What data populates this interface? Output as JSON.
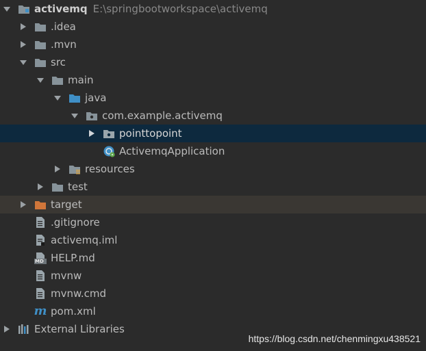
{
  "tree": {
    "root": {
      "label": "activemq",
      "path": "E:\\springbootworkspace\\activemq"
    },
    "items": [
      {
        "label": ".idea"
      },
      {
        "label": ".mvn"
      },
      {
        "label": "src"
      },
      {
        "label": "main"
      },
      {
        "label": "java"
      },
      {
        "label": "com.example.activemq"
      },
      {
        "label": "pointtopoint"
      },
      {
        "label": "ActivemqApplication"
      },
      {
        "label": "resources"
      },
      {
        "label": "test"
      },
      {
        "label": "target"
      },
      {
        "label": ".gitignore"
      },
      {
        "label": "activemq.iml"
      },
      {
        "label": "HELP.md"
      },
      {
        "label": "mvnw"
      },
      {
        "label": "mvnw.cmd"
      },
      {
        "label": "pom.xml"
      },
      {
        "label": "External Libraries"
      }
    ]
  },
  "icons": {
    "md_badge": "MD",
    "maven_letter": "m"
  },
  "watermark": "https://blog.csdn.net/chenmingxu438521",
  "colors": {
    "background": "#2b2b2b",
    "selected_row": "#0d293e",
    "highlight_row": "#3a3733",
    "folder": "#87939a",
    "source_folder": "#3f8fc6",
    "excluded_folder": "#d0763a",
    "text": "#bbbbbb"
  }
}
